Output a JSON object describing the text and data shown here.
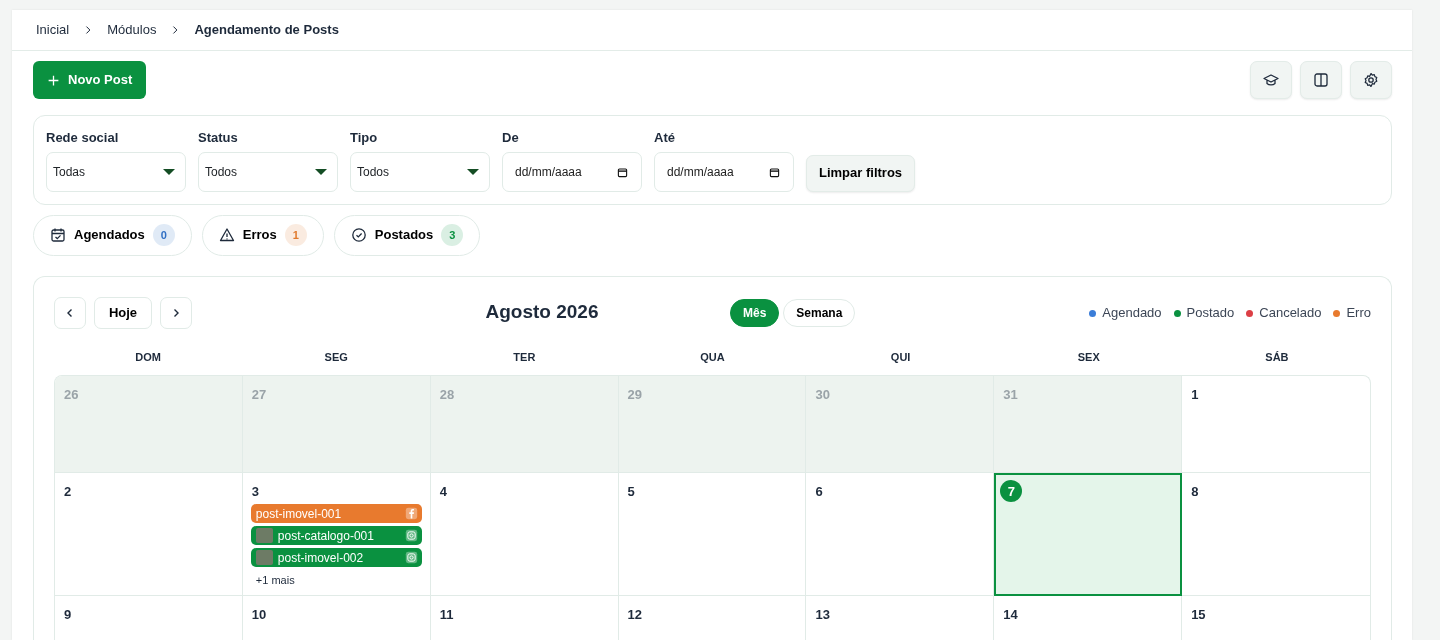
{
  "breadcrumb": [
    {
      "label": "Inicial",
      "current": false
    },
    {
      "label": "Módulos",
      "current": false
    },
    {
      "label": "Agendamento de Posts",
      "current": true
    }
  ],
  "toolbar": {
    "new_post": "Novo Post",
    "icon_buttons": [
      {
        "kind": "graduation"
      },
      {
        "kind": "columns"
      },
      {
        "kind": "settings"
      }
    ]
  },
  "filters": [
    {
      "kind": "select",
      "label": "Rede social",
      "value": "Todas"
    },
    {
      "kind": "select",
      "label": "Status",
      "value": "Todos"
    },
    {
      "kind": "select",
      "label": "Tipo",
      "value": "Todos"
    },
    {
      "kind": "date",
      "label": "De",
      "placeholder": "dd/mm/aaaa"
    },
    {
      "kind": "date",
      "label": "Até",
      "placeholder": "dd/mm/aaaa"
    }
  ],
  "clear_filters": "Limpar filtros",
  "status_tabs": [
    {
      "kind": "scheduled",
      "label": "Agendados",
      "count": "0",
      "color": "#2f6fc4"
    },
    {
      "kind": "error",
      "label": "Erros",
      "count": "1",
      "color": "#e0792c"
    },
    {
      "kind": "posted",
      "label": "Postados",
      "count": "3",
      "color": "#0a9140"
    }
  ],
  "calendar": {
    "title": "Agosto 2026",
    "today_button": "Hoje",
    "views": [
      {
        "label": "Mês",
        "selected": true
      },
      {
        "label": "Semana",
        "selected": false
      }
    ],
    "legend": [
      {
        "label": "Agendado",
        "color": "#3b7dd8"
      },
      {
        "label": "Postado",
        "color": "#0a9140"
      },
      {
        "label": "Cancelado",
        "color": "#dc3f45"
      },
      {
        "label": "Erro",
        "color": "#e87a2e"
      }
    ],
    "weekdays": [
      "DOM",
      "SEG",
      "TER",
      "QUA",
      "QUI",
      "SEX",
      "SÁB"
    ],
    "weeks": [
      [
        {
          "day": "26",
          "outside": true,
          "today": false
        },
        {
          "day": "27",
          "outside": true,
          "today": false
        },
        {
          "day": "28",
          "outside": true,
          "today": false
        },
        {
          "day": "29",
          "outside": true,
          "today": false
        },
        {
          "day": "30",
          "outside": true,
          "today": false
        },
        {
          "day": "31",
          "outside": true,
          "today": false
        },
        {
          "day": "1",
          "outside": false,
          "today": false
        }
      ],
      [
        {
          "day": "2",
          "outside": false,
          "today": false
        },
        {
          "day": "3",
          "outside": false,
          "today": false,
          "events": [
            {
              "title": "post-imovel-001",
              "color": "#e87a2e",
              "thumbnail": false,
              "kind": "facebook"
            },
            {
              "title": "post-catalogo-001",
              "color": "#0a9140",
              "thumbnail": true,
              "kind": "instagram"
            },
            {
              "title": "post-imovel-002",
              "color": "#0a9140",
              "thumbnail": true,
              "kind": "instagram"
            }
          ],
          "more": "+1 mais"
        },
        {
          "day": "4",
          "outside": false,
          "today": false
        },
        {
          "day": "5",
          "outside": false,
          "today": false
        },
        {
          "day": "6",
          "outside": false,
          "today": false
        },
        {
          "day": "7",
          "outside": false,
          "today": true
        },
        {
          "day": "8",
          "outside": false,
          "today": false
        }
      ],
      [
        {
          "day": "9",
          "outside": false,
          "today": false
        },
        {
          "day": "10",
          "outside": false,
          "today": false
        },
        {
          "day": "11",
          "outside": false,
          "today": false
        },
        {
          "day": "12",
          "outside": false,
          "today": false
        },
        {
          "day": "13",
          "outside": false,
          "today": false
        },
        {
          "day": "14",
          "outside": false,
          "today": false
        },
        {
          "day": "15",
          "outside": false,
          "today": false
        }
      ]
    ]
  }
}
